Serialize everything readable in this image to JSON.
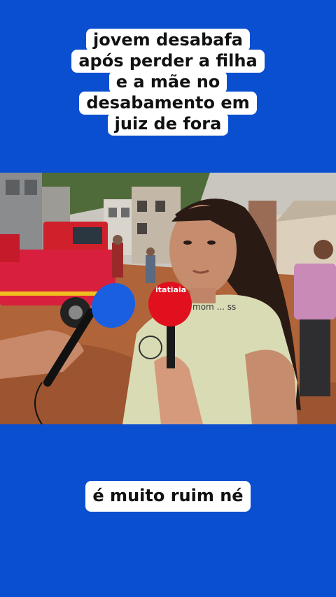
{
  "title": {
    "lines": [
      "jovem desabafa",
      "após perder a filha",
      "e a mãe no",
      "desabamento em",
      "juiz de fora"
    ]
  },
  "photo": {
    "mic_brand": "itatiaia",
    "shirt_text": "mom ... ss"
  },
  "caption": "é muito ruim né",
  "colors": {
    "background": "#0a4fd0",
    "text_box": "#ffffff",
    "mic_red": "#e0101e",
    "mic_blue": "#1a5fe0",
    "mud": "#b0643a"
  }
}
